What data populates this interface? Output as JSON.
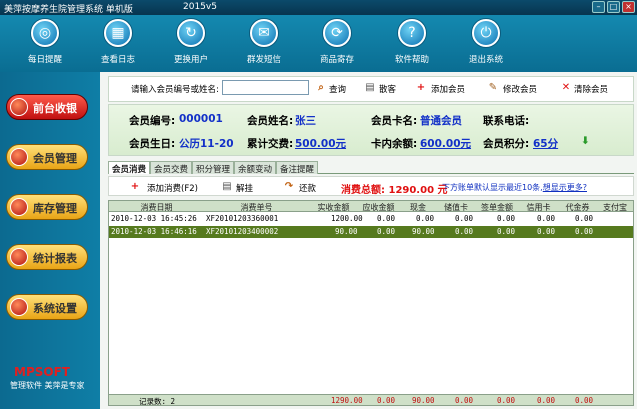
{
  "window": {
    "title": "美萍按摩养生院管理系统 单机版",
    "version": "2015v5"
  },
  "toolbar": {
    "items": [
      {
        "label": "每日提醒",
        "icon": "lifebuoy-icon"
      },
      {
        "label": "查看日志",
        "icon": "calendar-icon"
      },
      {
        "label": "更换用户",
        "icon": "refresh-user-icon"
      },
      {
        "label": "群发短信",
        "icon": "sms-icon"
      },
      {
        "label": "商品寄存",
        "icon": "storage-icon"
      },
      {
        "label": "软件帮助",
        "icon": "help-icon"
      },
      {
        "label": "退出系统",
        "icon": "power-icon"
      }
    ]
  },
  "sidebar": {
    "items": [
      {
        "label": "前台收银",
        "active": true
      },
      {
        "label": "会员管理",
        "active": false
      },
      {
        "label": "库存管理",
        "active": false
      },
      {
        "label": "统计报表",
        "active": false
      },
      {
        "label": "系统设置",
        "active": false
      }
    ],
    "logo": "MPSOFT",
    "slogan": "管理软件  美萍是专家"
  },
  "actionbar": {
    "search_label": "请输入会员编号或姓名:",
    "search_value": "",
    "query": "查询",
    "scatter_guest": "散客",
    "add_member": "添加会员",
    "edit_member": "修改会员",
    "clear_member": "清除会员"
  },
  "member": {
    "id_label": "会员编号:",
    "id": "000001",
    "name_label": "会员姓名:",
    "name": "张三",
    "card_label": "会员卡名:",
    "card": "普通会员",
    "phone_label": "联系电话:",
    "phone": "",
    "birthday_label": "会员生日:",
    "birthday": "公历11-20",
    "spent_label": "累计交费:",
    "spent": "500.00元",
    "balance_label": "卡内余额:",
    "balance": "600.00元",
    "points_label": "会员积分:",
    "points": "65分"
  },
  "tabs": [
    {
      "label": "会员消费",
      "active": true
    },
    {
      "label": "会员交费",
      "active": false
    },
    {
      "label": "积分管理",
      "active": false
    },
    {
      "label": "余额变动",
      "active": false
    },
    {
      "label": "备注提醒",
      "active": false
    }
  ],
  "subbar": {
    "add": "添加消费(F2)",
    "checkout": "解挂",
    "refund": "还款",
    "total_label": "消费总额: 1290.00 元",
    "hint": "下方账单默认显示最近10条,",
    "hint_link": "想显示更多?"
  },
  "grid": {
    "columns": [
      "消费日期",
      "消费单号",
      "实收金额",
      "应收金额",
      "现金",
      "储值卡",
      "签单金额",
      "信用卡",
      "代金券",
      "支付宝"
    ],
    "rows": [
      [
        "2010-12-03 16:45:26",
        "XF20101203360001",
        "1200.00",
        "0.00",
        "0.00",
        "0.00",
        "0.00",
        "0.00",
        "0.00",
        ""
      ],
      [
        "2010-12-03 16:46:16",
        "XF20101203400002",
        "90.00",
        "0.00",
        "90.00",
        "0.00",
        "0.00",
        "0.00",
        "0.00",
        ""
      ]
    ],
    "footer": {
      "count": "记录数: 2",
      "amount": "1290.00",
      "due": "0.00",
      "cash": "90.00",
      "card": "0.00",
      "sign": "0.00",
      "credit": "0.00",
      "coupon": "0.00"
    }
  },
  "colors": {
    "accent": "#0d6a8c",
    "selected_row": "#567a1e",
    "total": "#e01010",
    "value": "#1230c8"
  }
}
